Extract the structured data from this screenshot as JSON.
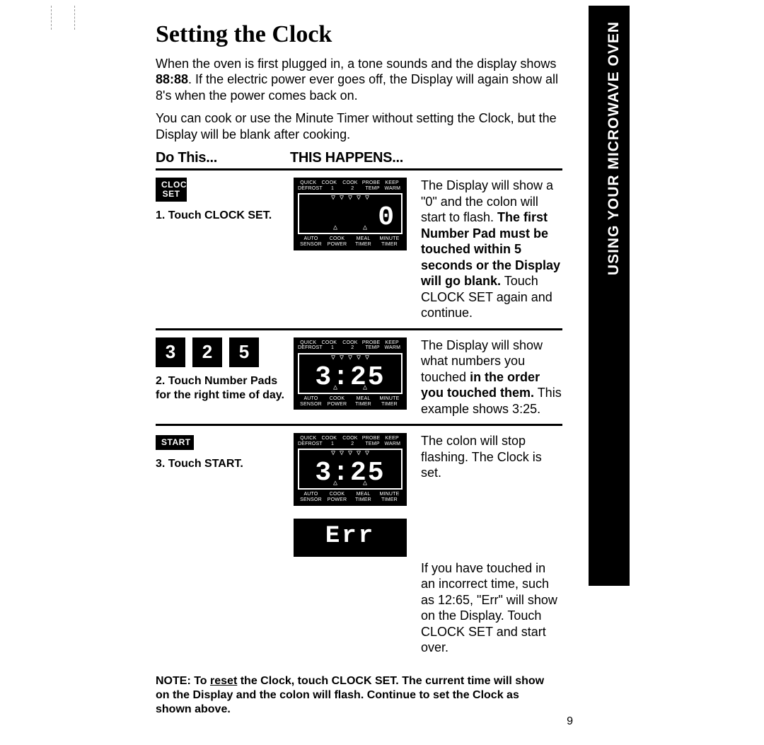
{
  "sideLabel": "USING YOUR MICROWAVE OVEN",
  "title": "Setting the Clock",
  "intro": {
    "p1a": "When the oven is first plugged in, a tone sounds and the display shows ",
    "p1b": "88:88",
    "p1c": ". If the electric power ever goes off, the Display will again show all 8's when the power comes back on.",
    "p2": "You can cook or use the Minute Timer without setting the Clock, but the Display will be blank after cooking."
  },
  "headers": {
    "doThis": "Do This...",
    "thisHappens": "This Happens..."
  },
  "displayLabels": {
    "top": [
      "QUICK",
      "COOK",
      "COOK",
      "PROBE",
      "KEEP"
    ],
    "top2": [
      "DEFROST",
      "1",
      "2",
      "TEMP",
      "WARM"
    ],
    "bot1": [
      "AUTO",
      "COOK",
      "MEAL",
      "MINUTE"
    ],
    "bot2": [
      "SENSOR",
      "POWER",
      "TIMER",
      "TIMER"
    ]
  },
  "steps": {
    "s1": {
      "button": "CLOCK SET",
      "action": "1. Touch CLOCK SET.",
      "seg": "0",
      "right": {
        "a": "The Display will show a \"0\" and the colon will start to flash. ",
        "b": "The first Number Pad must be touched within 5 seconds or the Display will go blank.",
        "c": " Touch CLOCK SET again and continue."
      }
    },
    "s2": {
      "nums": [
        "3",
        "2",
        "5"
      ],
      "action": "2. Touch Number Pads for the right time of day.",
      "seg": "3:25",
      "right": {
        "a": "The Display will show what numbers you touched ",
        "b": "in the order you touched them.",
        "c": " This example shows 3:25."
      }
    },
    "s3": {
      "button": "START",
      "action": "3. Touch START.",
      "seg": "3:25",
      "right": "The colon will stop flashing. The Clock is set."
    },
    "err": {
      "seg": "Err",
      "right": "If you have touched in an incorrect time, such as 12:65, \"Err\" will show on the Display. Touch CLOCK SET and start over."
    }
  },
  "note": {
    "a": "NOTE: To ",
    "reset": "reset",
    "b": " the Clock, touch CLOCK SET. The current time will show on the Display and the colon will flash. Continue to set the Clock as shown above."
  },
  "pageNumber": "9"
}
